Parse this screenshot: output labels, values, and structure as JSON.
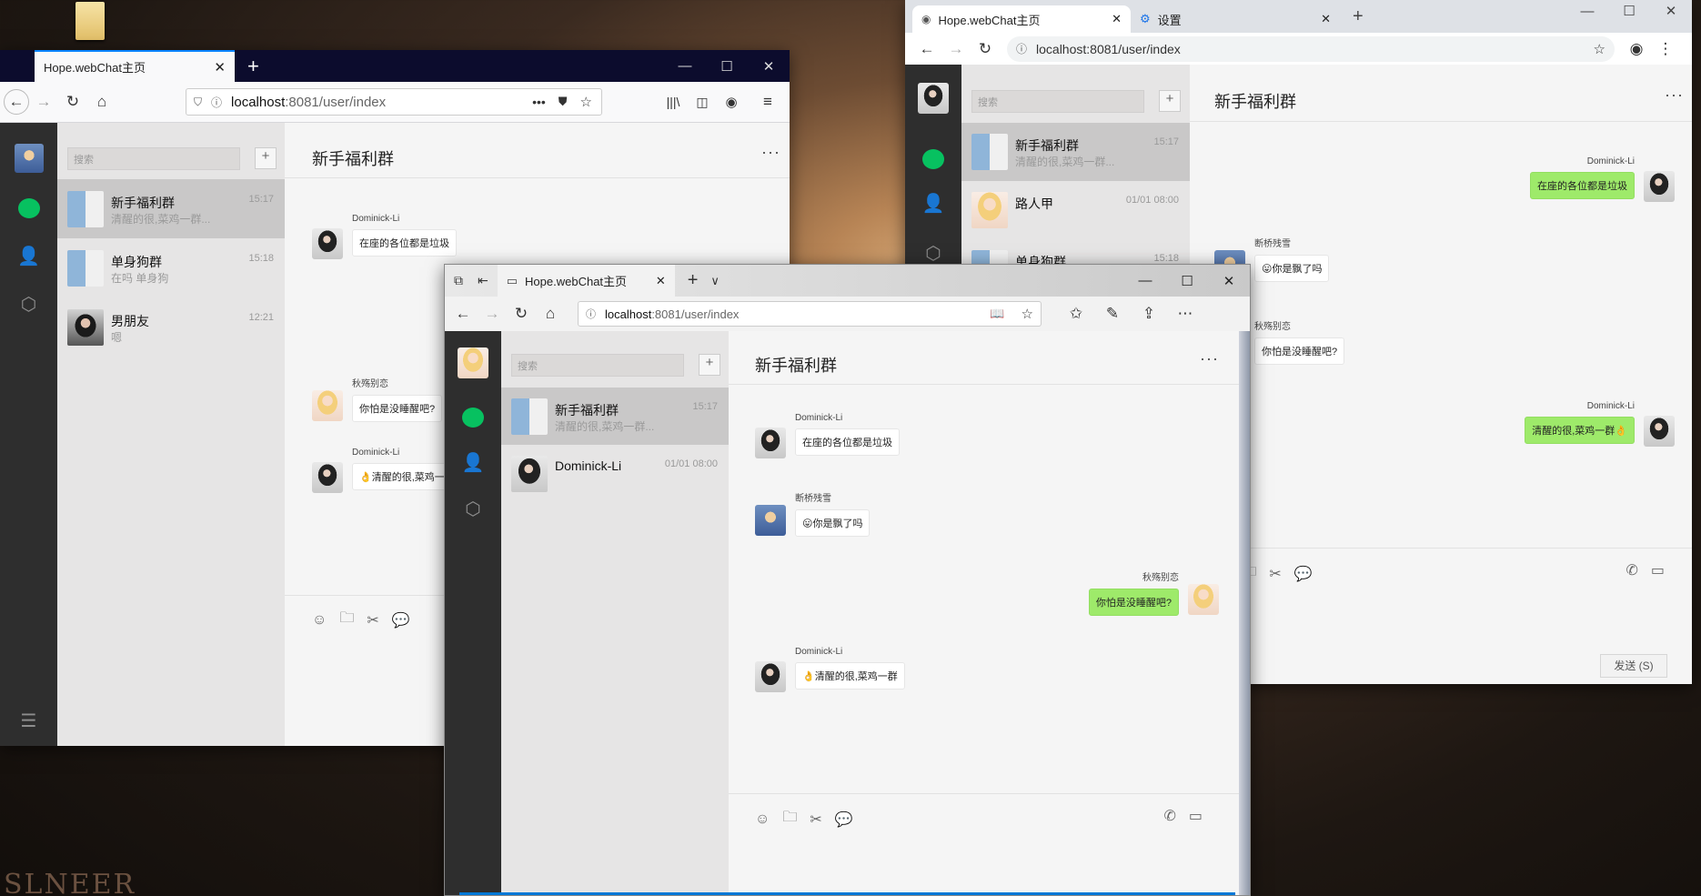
{
  "desktop": {
    "folder_icon": "folder-icon",
    "folder_label": "",
    "watermark": "SLNEER"
  },
  "w1": {
    "tab_title": "Hope.webChat主页",
    "url_host": "localhost",
    "url_path": ":8081/user/index",
    "app": {
      "search_placeholder": "搜索",
      "add_label": "+",
      "conversations": [
        {
          "name": "新手福利群",
          "time": "15:17",
          "last": "清醒的很,菜鸡一群..."
        },
        {
          "name": "单身狗群",
          "time": "15:18",
          "last": "在吗 单身狗"
        },
        {
          "name": "男朋友",
          "time": "12:21",
          "last": "嗯"
        }
      ],
      "chat_title": "新手福利群",
      "more": "···",
      "messages": [
        {
          "sender": "Dominick-Li",
          "text": "在座的各位都是垃圾"
        },
        {
          "sender": "秋殇别恋",
          "text": "你怕是没睡醒吧?"
        },
        {
          "sender": "Dominick-Li",
          "text": "👌清醒的很,菜鸡一群"
        }
      ],
      "menu_icon": "☰"
    }
  },
  "w2": {
    "tabs": [
      {
        "title": "Hope.webChat主页"
      },
      {
        "title": "设置"
      }
    ],
    "url": "localhost:8081/user/index",
    "app": {
      "search_placeholder": "搜索",
      "add_label": "+",
      "conversations": [
        {
          "name": "新手福利群",
          "time": "15:17",
          "last": "清醒的很,菜鸡一群..."
        },
        {
          "name": "路人甲",
          "time": "01/01 08:00",
          "last": ""
        },
        {
          "name": "单身狗群",
          "time": "15:18",
          "last": ""
        }
      ],
      "chat_title": "新手福利群",
      "more": "···",
      "messages": [
        {
          "sender": "Dominick-Li",
          "text": "在座的各位都是垃圾"
        },
        {
          "sender": "断桥残雪",
          "text": "😛你是飘了吗"
        },
        {
          "sender": "秋殇别恋",
          "text": "你怕是没睡醒吧?"
        },
        {
          "sender": "Dominick-Li",
          "text": "清醒的很,菜鸡一群👌"
        }
      ],
      "send_label": "发送 (S)"
    }
  },
  "w3": {
    "tab_title": "Hope.webChat主页",
    "url_host": "localhost",
    "url_path": ":8081/user/index",
    "app": {
      "search_placeholder": "搜索",
      "add_label": "+",
      "conversations": [
        {
          "name": "新手福利群",
          "time": "15:17",
          "last": "清醒的很,菜鸡一群..."
        },
        {
          "name": "Dominick-Li",
          "time": "01/01 08:00",
          "last": ""
        }
      ],
      "chat_title": "新手福利群",
      "more": "···",
      "messages": [
        {
          "sender": "Dominick-Li",
          "text": "在座的各位都是垃圾"
        },
        {
          "sender": "断桥残雪",
          "text": "😛你是飘了吗"
        },
        {
          "sender": "秋殇别恋",
          "text": "你怕是没睡醒吧?"
        },
        {
          "sender": "Dominick-Li",
          "text": "👌清醒的很,菜鸡一群"
        }
      ]
    }
  }
}
